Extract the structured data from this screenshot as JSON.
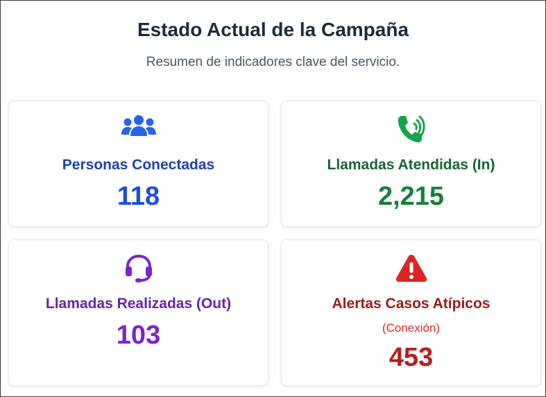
{
  "header": {
    "title": "Estado Actual de la Campaña",
    "subtitle": "Resumen de indicadores clave del servicio."
  },
  "cards": [
    {
      "label": "Personas Conectadas",
      "value": "118",
      "icon": "users-icon",
      "color": "#1d4ed8"
    },
    {
      "label": "Llamadas Atendidas (In)",
      "value": "2,215",
      "icon": "phone-volume-icon",
      "color": "#15803d"
    },
    {
      "label": "Llamadas Realizadas (Out)",
      "value": "103",
      "icon": "headset-icon",
      "color": "#7e22ce"
    },
    {
      "label": "Alertas Casos Atípicos",
      "sublabel": "(Conexión)",
      "value": "453",
      "icon": "warning-triangle-icon",
      "color": "#b91c1c"
    }
  ]
}
